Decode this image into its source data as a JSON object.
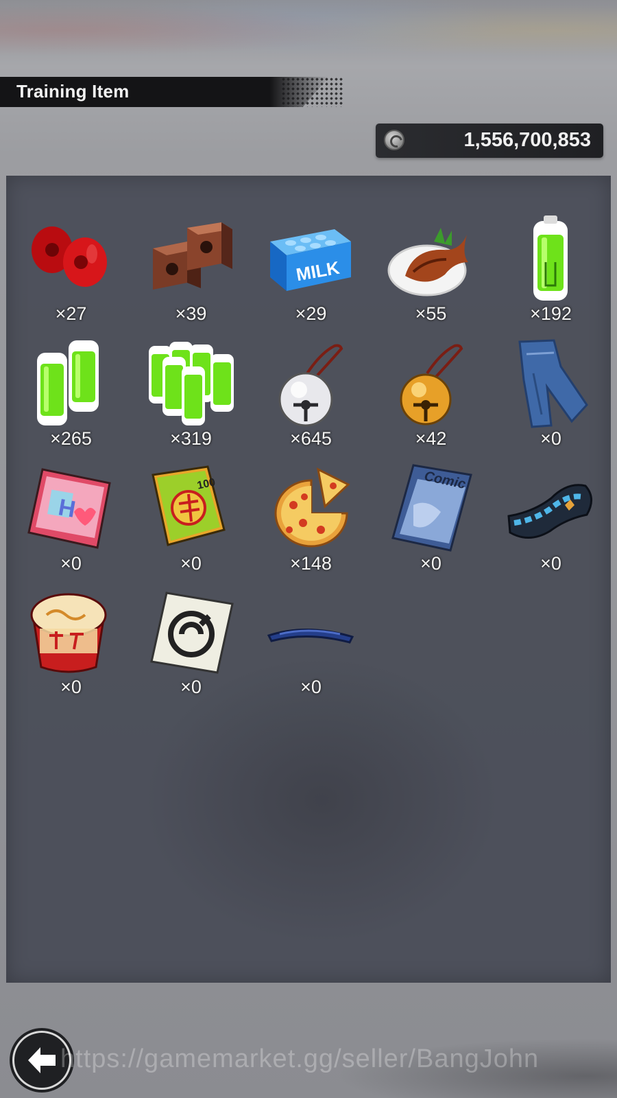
{
  "header": {
    "title": "Training Item"
  },
  "currency": {
    "icon": "coin-icon",
    "value": "1,556,700,853"
  },
  "items": [
    {
      "name": "red-dumbbell",
      "icon": "red-dumbbell-icon",
      "count": "×27"
    },
    {
      "name": "brick-weights",
      "icon": "brick-weights-icon",
      "count": "×39"
    },
    {
      "name": "milk-crate",
      "icon": "milk-crate-icon",
      "label": "MILK",
      "count": "×29"
    },
    {
      "name": "grilled-fish",
      "icon": "grilled-fish-icon",
      "count": "×55"
    },
    {
      "name": "battery-single",
      "icon": "battery-icon",
      "count": "×192"
    },
    {
      "name": "battery-double",
      "icon": "battery-pair-icon",
      "count": "×265"
    },
    {
      "name": "battery-pack",
      "icon": "battery-pack-icon",
      "count": "×319"
    },
    {
      "name": "silver-bell",
      "icon": "silver-bell-icon",
      "count": "×645"
    },
    {
      "name": "gold-bell",
      "icon": "gold-bell-icon",
      "count": "×42"
    },
    {
      "name": "jeans",
      "icon": "jeans-icon",
      "count": "×0"
    },
    {
      "name": "pink-book",
      "icon": "pink-book-icon",
      "count": "×0"
    },
    {
      "name": "quiz-book",
      "icon": "quiz-book-icon",
      "label": "100",
      "count": "×0"
    },
    {
      "name": "pizza",
      "icon": "pizza-icon",
      "count": "×148"
    },
    {
      "name": "comic-book",
      "icon": "comic-book-icon",
      "label": "Comic",
      "count": "×0"
    },
    {
      "name": "wristband",
      "icon": "wristband-icon",
      "count": "×0"
    },
    {
      "name": "ramen-cup",
      "icon": "ramen-cup-icon",
      "count": "×0"
    },
    {
      "name": "symbol-card",
      "icon": "symbol-card-icon",
      "count": "×0"
    },
    {
      "name": "blue-headband",
      "icon": "headband-icon",
      "count": "×0"
    }
  ],
  "back_button": {
    "icon": "back-arrow-icon"
  },
  "watermark": "https://gamemarket.gg/seller/BangJohn",
  "colors": {
    "panel": "#484b56",
    "header": "#141416",
    "text": "#f4f4f4"
  }
}
